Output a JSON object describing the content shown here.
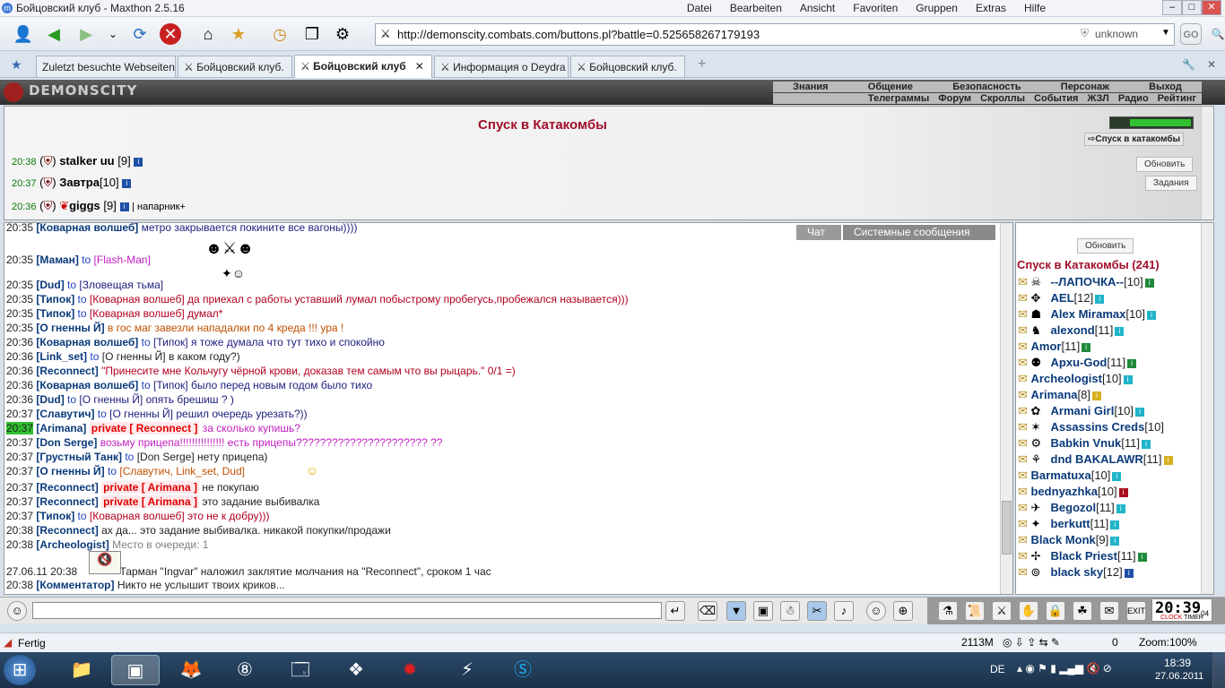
{
  "window": {
    "title": "Бойцовский клуб - Maxthon 2.5.16"
  },
  "menu": [
    "Datei",
    "Bearbeiten",
    "Ansicht",
    "Favoriten",
    "Gruppen",
    "Extras",
    "Hilfe"
  ],
  "address": {
    "url": "http://demonscity.combats.com/buttons.pl?battle=0.525658267179193",
    "security": "unknown"
  },
  "tabs": [
    {
      "label": "Zuletzt besuchte Webseiten"
    },
    {
      "label": "Бойцовский клуб."
    },
    {
      "label": "Бойцовский клуб"
    },
    {
      "label": "Информация о Deydra"
    },
    {
      "label": "Бойцовский клуб."
    }
  ],
  "game": {
    "logo": "DEMONSCITY",
    "nav_top": [
      "Знания",
      "Общение",
      "Безопасность",
      "Персонаж",
      "Выход"
    ],
    "nav_bottom": [
      "Телеграммы",
      "Форум",
      "Скроллы",
      "События",
      "ЖЗЛ",
      "Радио",
      "Рейтинг"
    ],
    "location_title": "Спуск в Катакомбы",
    "location_link": "Спуск в катакомбы",
    "refresh_label": "Обновить",
    "quests_label": "Задания",
    "players": [
      {
        "time": "20:38",
        "name": "stalker uu",
        "level": "[9]",
        "note": ""
      },
      {
        "time": "20:37",
        "name": "Завтра",
        "level": "[10]",
        "note": ""
      },
      {
        "time": "20:36",
        "name": "giggs",
        "level": "[9]",
        "note": "| напарник+"
      }
    ]
  },
  "chat_tabs": [
    "Чат",
    "Системные сообщения"
  ],
  "chat": [
    {
      "time": "20:35",
      "nick": "[Коварная волшеб]",
      "to": "",
      "text": "метро закрывается покините все вагоны))))",
      "cls": "tx"
    },
    {
      "time": "20:35",
      "nick": "[Маман]",
      "to": "to",
      "text": "[Flash-Man]",
      "cls": "txm"
    },
    {
      "time": "20:35",
      "nick": "[Dud]",
      "to": "to",
      "text": "[Зловещая тьма]",
      "cls": "tx"
    },
    {
      "time": "20:35",
      "nick": "[Типок]",
      "to": "to",
      "text": "[Коварная волшеб] да приехал с работы уставший лумал побыстрому пробегусь,пробежался называется)))",
      "cls": "txr"
    },
    {
      "time": "20:35",
      "nick": "[Типок]",
      "to": "to",
      "text": "[Коварная волшеб] думал*",
      "cls": "txr"
    },
    {
      "time": "20:35",
      "nick": "[О гненны Й]",
      "to": "",
      "text": "в гос маг завезли нападалки по 4 креда !!! ура !",
      "cls": "txo"
    },
    {
      "time": "20:36",
      "nick": "[Коварная волшеб]",
      "to": "to",
      "text": "[Типок] я тоже думала что тут тихо и спокойно",
      "cls": "tx"
    },
    {
      "time": "20:36",
      "nick": "[Link_set]",
      "to": "to",
      "text": "[О гненны Й] в каком году?)",
      "cls": "txb"
    },
    {
      "time": "20:36",
      "nick": "[Reconnect]",
      "to": "",
      "text": "\"Принесите мне Кольчугу чёрной крови, доказав тем самым что вы рыцарь.\" 0/1 =)",
      "cls": "txr"
    },
    {
      "time": "20:36",
      "nick": "[Коварная волшеб]",
      "to": "to",
      "text": "[Типок] было перед новым годом было тихо",
      "cls": "tx"
    },
    {
      "time": "20:36",
      "nick": "[Dud]",
      "to": "to",
      "text": "[О гненны Й] опять брешиш ? )",
      "cls": "tx"
    },
    {
      "time": "20:37",
      "nick": "[Славутич]",
      "to": "to",
      "text": "[О гненны Й] решил очередь урезать?))",
      "cls": "tx"
    },
    {
      "time": "20:37",
      "nick": "[Arimana]",
      "to": "private [ Reconnect ]",
      "text": "за сколько купишь?",
      "cls": "txm"
    },
    {
      "time": "20:37",
      "nick": "[Don Serge]",
      "to": "",
      "text": "возьму прицепа!!!!!!!!!!!!!!! есть прицепы?????????????????????? ??",
      "cls": "txm"
    },
    {
      "time": "20:37",
      "nick": "[Грустный Танк]",
      "to": "to",
      "text": "[Don Serge] нету прицепа)",
      "cls": "txb"
    },
    {
      "time": "20:37",
      "nick": "[О гненны Й]",
      "to": "to",
      "text": "[Славутич, Link_set, Dud]",
      "cls": "txo"
    },
    {
      "time": "20:37",
      "nick": "[Reconnect]",
      "to": "private [ Arimana ]",
      "text": "не покупаю",
      "cls": "txb"
    },
    {
      "time": "20:37",
      "nick": "[Reconnect]",
      "to": "private [ Arimana ]",
      "text": "это задание выбивалка",
      "cls": "txb"
    },
    {
      "time": "20:37",
      "nick": "[Типок]",
      "to": "to",
      "text": "[Коварная волшеб] это не к добру)))",
      "cls": "txr"
    },
    {
      "time": "20:38",
      "nick": "[Reconnect]",
      "to": "",
      "text": "ах да... это задание выбивалка. никакой покупки/продажи",
      "cls": "txb"
    },
    {
      "time": "20:38",
      "nick": "[Archeologist]",
      "to": "",
      "text": "Место в очереди: 1",
      "cls": "txg"
    },
    {
      "time": "27.06.11 20:38",
      "nick": "",
      "to": "",
      "text": "Тарман \"Ingvar\" наложил заклятие молчания на \"Reconnect\", сроком 1 час",
      "cls": "txb"
    },
    {
      "time": "20:38",
      "nick": "[Комментатор]",
      "to": "",
      "text": "Никто не услышит твоих криков...",
      "cls": "txb"
    }
  ],
  "room": {
    "refresh_label": "Обновить",
    "title": "Спуск в Катакомбы (241)",
    "players": [
      {
        "name": "--ЛАПОЧКА--",
        "level": "[10]",
        "info": "g"
      },
      {
        "name": "AEL",
        "level": "[12]",
        "info": "c"
      },
      {
        "name": "Alex Miramax",
        "level": "[10]",
        "info": "c"
      },
      {
        "name": "alexond",
        "level": "[11]",
        "info": "c"
      },
      {
        "name": "Amor",
        "level": "[11]",
        "info": "g"
      },
      {
        "name": "Apxu-God",
        "level": "[11]",
        "info": "g"
      },
      {
        "name": "Archeologist",
        "level": "[10]",
        "info": "c"
      },
      {
        "name": "Arimana",
        "level": "[8]",
        "info": "y"
      },
      {
        "name": "Armani Girl",
        "level": "[10]",
        "info": "c"
      },
      {
        "name": "Assassins Creds",
        "level": "[10]",
        "info": ""
      },
      {
        "name": "Babkin Vnuk",
        "level": "[11]",
        "info": "c"
      },
      {
        "name": "dnd BAKALAWR",
        "level": "[11]",
        "info": "y"
      },
      {
        "name": "Barmatuxa",
        "level": "[10]",
        "info": "c"
      },
      {
        "name": "bednyazhka",
        "level": "[10]",
        "info": "r"
      },
      {
        "name": "Begozol",
        "level": "[11]",
        "info": "c"
      },
      {
        "name": "berkutt",
        "level": "[11]",
        "info": "c"
      },
      {
        "name": "Black Monk",
        "level": "[9]",
        "info": "c"
      },
      {
        "name": "Black Priest",
        "level": "[11]",
        "info": "g"
      },
      {
        "name": "black sky",
        "level": "[12]",
        "info": "b"
      }
    ]
  },
  "status": {
    "left": "Fertig",
    "memory": "2113M",
    "count": "0",
    "zoom": "Zoom:100%"
  },
  "clock": {
    "game_time": "20:39",
    "game_sec": "04",
    "label1": "CLOCK",
    "label2": "TIMER"
  },
  "taskbar": {
    "lang": "DE",
    "time": "18:39",
    "date": "27.06.2011"
  }
}
